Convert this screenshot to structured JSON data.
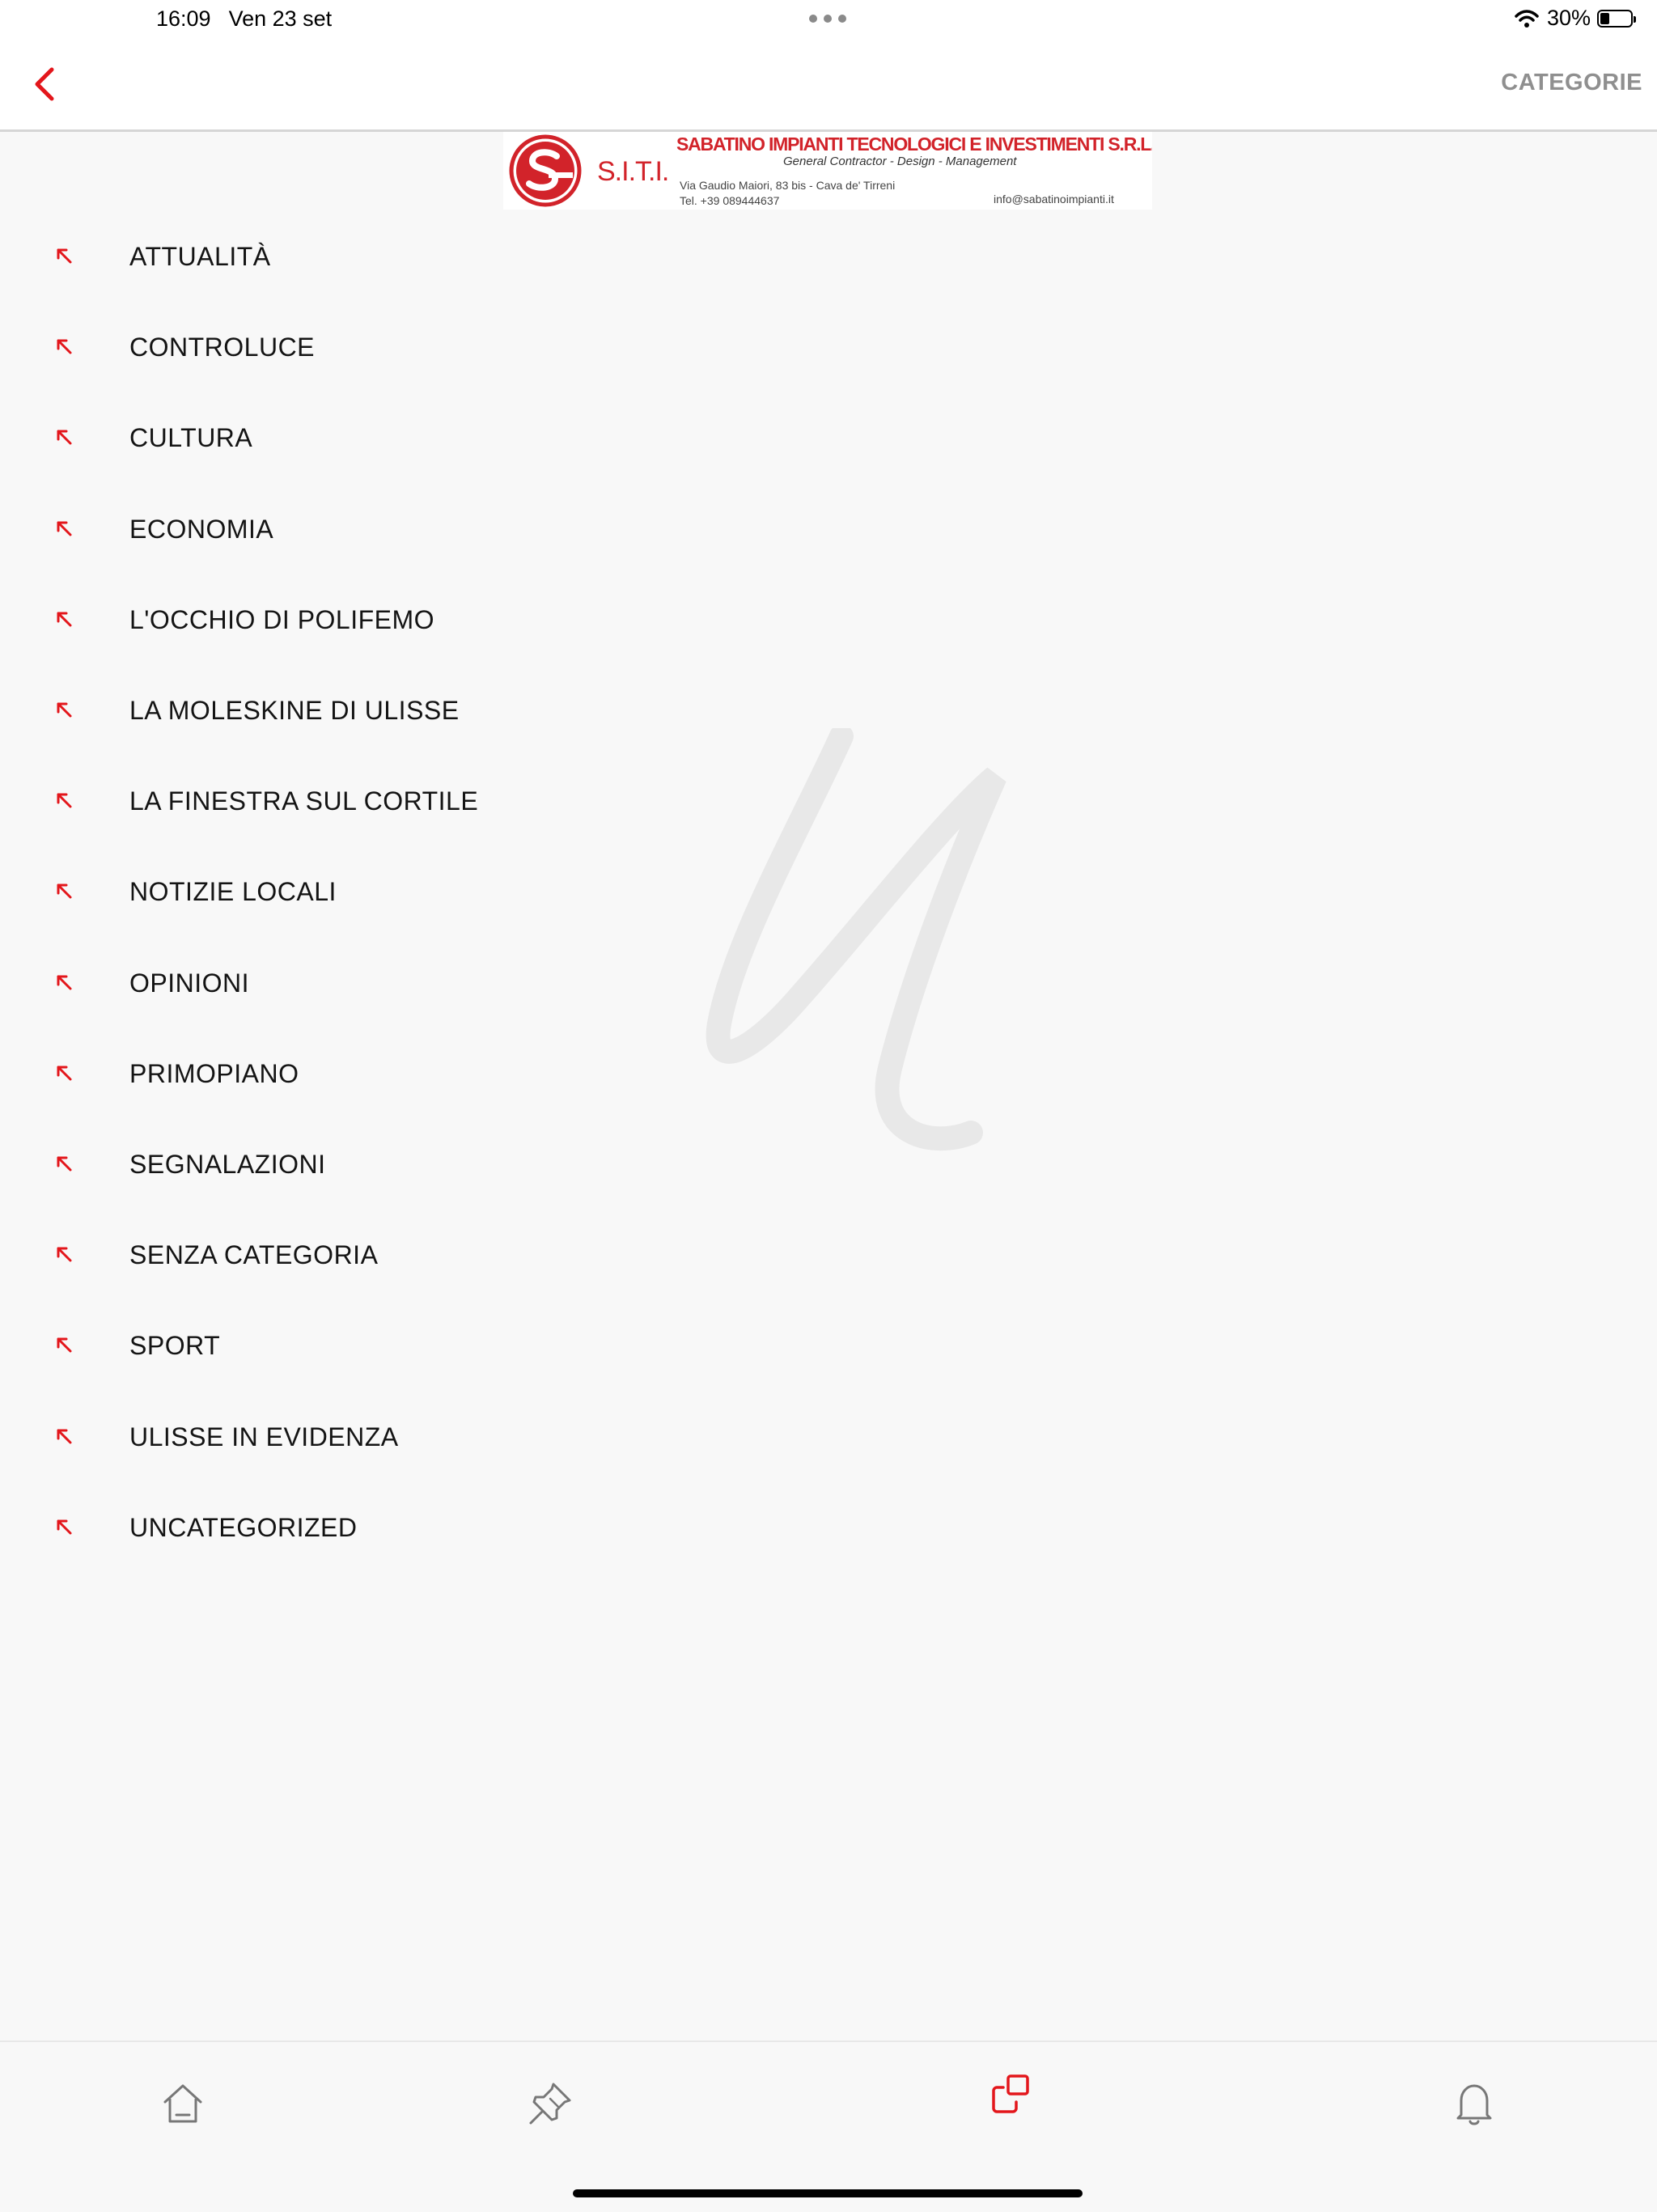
{
  "status_bar": {
    "time": "16:09",
    "date": "Ven 23 set",
    "battery": "30%",
    "battery_level": 0.3
  },
  "header": {
    "title": "CATEGORIE",
    "back_icon": "chevron-left-icon",
    "accent_color": "#e3161b"
  },
  "banner": {
    "logo_text": "S.I.T.I.",
    "company": "SABATINO IMPIANTI TECNOLOGICI E INVESTIMENTI S.R.L.",
    "tagline": "General Contractor - Design - Management",
    "address_line1": "Via Gaudio Maiori, 83 bis - Cava de' Tirreni",
    "address_line2": "Tel. +39 089444637",
    "email": "info@sabatinoimpianti.it"
  },
  "categories": [
    {
      "label": "ATTUALITÀ"
    },
    {
      "label": "CONTROLUCE"
    },
    {
      "label": "CULTURA"
    },
    {
      "label": "ECONOMIA"
    },
    {
      "label": "L'OCCHIO DI POLIFEMO"
    },
    {
      "label": "LA MOLESKINE DI ULISSE"
    },
    {
      "label": "LA FINESTRA SUL CORTILE"
    },
    {
      "label": "NOTIZIE LOCALI"
    },
    {
      "label": "OPINIONI"
    },
    {
      "label": "PRIMOPIANO"
    },
    {
      "label": "SEGNALAZIONI"
    },
    {
      "label": "SENZA CATEGORIA"
    },
    {
      "label": "SPORT"
    },
    {
      "label": "ULISSE IN EVIDENZA"
    },
    {
      "label": "UNCATEGORIZED"
    }
  ],
  "bottom_tabs": [
    {
      "name": "home",
      "icon": "home-icon",
      "active": false
    },
    {
      "name": "pinned",
      "icon": "pin-icon",
      "active": false
    },
    {
      "name": "categories",
      "icon": "categories-icon",
      "active": true
    },
    {
      "name": "notifications",
      "icon": "bell-icon",
      "active": false
    }
  ]
}
